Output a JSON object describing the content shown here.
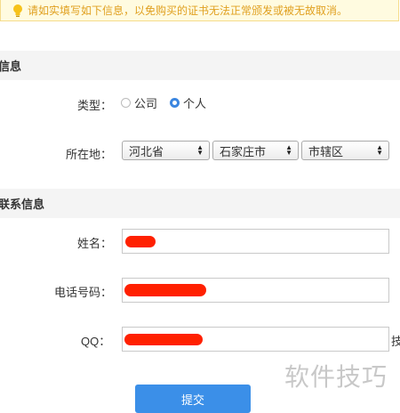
{
  "notice": {
    "text": "请如实填写如下信息，以免购买的证书无法正常颁发或被无故取消。",
    "icon": "lightbulb-icon"
  },
  "sections": {
    "info_title": "信息",
    "contact_title": "联系信息"
  },
  "form": {
    "type_label": "类型：",
    "type_options": [
      {
        "label": "公司",
        "checked": false
      },
      {
        "label": "个人",
        "checked": true
      }
    ],
    "location_label": "所在地：",
    "province": "河北省",
    "city": "石家庄市",
    "district": "市辖区",
    "name_label": "姓名：",
    "phone_label": "电话号码：",
    "qq_label": "QQ：",
    "side_text": "技",
    "submit_label": "提交"
  },
  "watermark": "软件技巧",
  "colors": {
    "accent": "#3b8fe8",
    "redaction": "#ff2000",
    "notice_bg": "#fffbe0"
  }
}
